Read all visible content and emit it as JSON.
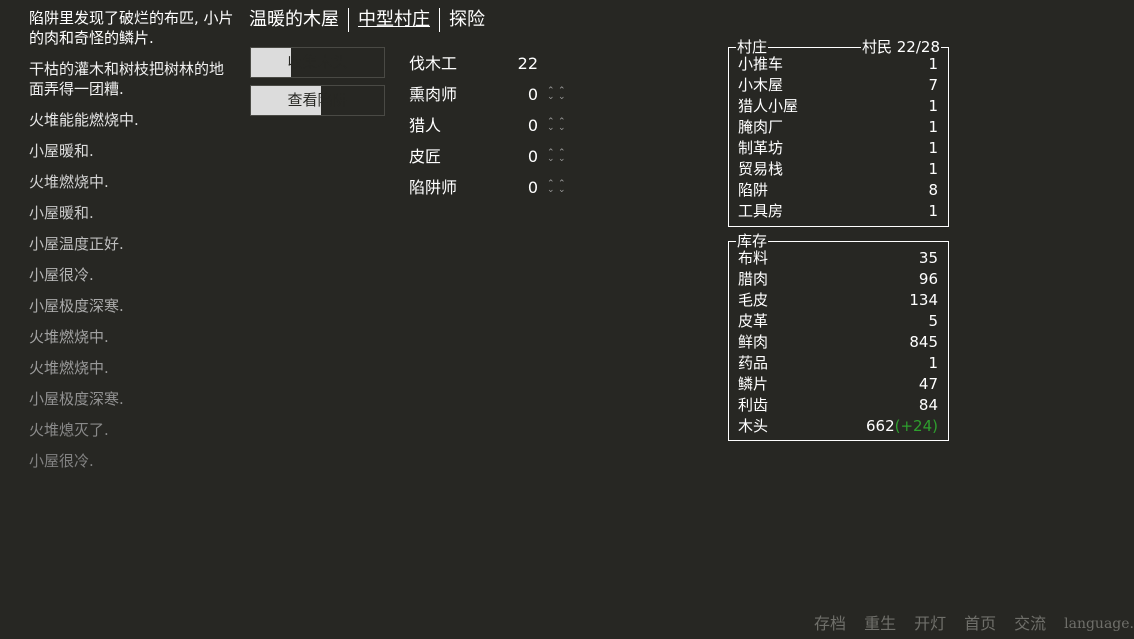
{
  "notifications": [
    {
      "text": "陷阱里发现了破烂的布匹, 小片的肉和奇怪的鳞片.",
      "color": "#ffffff"
    },
    {
      "text": "干枯的灌木和树枝把树林的地面弄得一团糟.",
      "color": "#f0f0f0"
    },
    {
      "text": "火堆能能燃烧中.",
      "color": "#e6e6e6"
    },
    {
      "text": "小屋暖和.",
      "color": "#dcdcdc"
    },
    {
      "text": "火堆燃烧中.",
      "color": "#d2d2d2"
    },
    {
      "text": "小屋暖和.",
      "color": "#c8c8c8"
    },
    {
      "text": "小屋温度正好.",
      "color": "#bebebe"
    },
    {
      "text": "小屋很冷.",
      "color": "#b4b4b4"
    },
    {
      "text": "小屋极度深寒.",
      "color": "#aaaaaa"
    },
    {
      "text": "火堆燃烧中.",
      "color": "#a2a2a2"
    },
    {
      "text": "火堆燃烧中.",
      "color": "#9a9a9a"
    },
    {
      "text": "小屋极度深寒.",
      "color": "#929292"
    },
    {
      "text": "火堆熄灭了.",
      "color": "#8a8a8a"
    },
    {
      "text": "小屋很冷.",
      "color": "#828282"
    }
  ],
  "header": {
    "tabs": [
      {
        "label": "温暖的木屋",
        "selected": false
      },
      {
        "label": "中型村庄",
        "selected": true
      },
      {
        "label": "探险",
        "selected": false
      }
    ]
  },
  "actions": {
    "gather": {
      "label": "收集木头",
      "cooldown_progress": 0.3
    },
    "traps": {
      "label": "查看陷阱",
      "cooldown_progress": 0.53
    }
  },
  "workers": [
    {
      "name": "伐木工",
      "count": "22",
      "arrows": false
    },
    {
      "name": "熏肉师",
      "count": "0",
      "arrows": true
    },
    {
      "name": "猎人",
      "count": "0",
      "arrows": true
    },
    {
      "name": "皮匠",
      "count": "0",
      "arrows": true
    },
    {
      "name": "陷阱师",
      "count": "0",
      "arrows": true
    }
  ],
  "village": {
    "legend": "村庄",
    "population_label": "村民 22/28",
    "buildings": [
      {
        "name": "小推车",
        "count": "1"
      },
      {
        "name": "小木屋",
        "count": "7"
      },
      {
        "name": "猎人小屋",
        "count": "1"
      },
      {
        "name": "腌肉厂",
        "count": "1"
      },
      {
        "name": "制革坊",
        "count": "1"
      },
      {
        "name": "贸易栈",
        "count": "1"
      },
      {
        "name": "陷阱",
        "count": "8"
      },
      {
        "name": "工具房",
        "count": "1"
      }
    ]
  },
  "stores": {
    "legend": "库存",
    "items": [
      {
        "name": "布料",
        "count": "35",
        "income": ""
      },
      {
        "name": "腊肉",
        "count": "96",
        "income": ""
      },
      {
        "name": "毛皮",
        "count": "134",
        "income": ""
      },
      {
        "name": "皮革",
        "count": "5",
        "income": ""
      },
      {
        "name": "鲜肉",
        "count": "845",
        "income": ""
      },
      {
        "name": "药品",
        "count": "1",
        "income": ""
      },
      {
        "name": "鳞片",
        "count": "47",
        "income": ""
      },
      {
        "name": "利齿",
        "count": "84",
        "income": ""
      },
      {
        "name": "木头",
        "count": "662",
        "income": "(+24)"
      }
    ]
  },
  "footer": {
    "links": [
      "存档",
      "重生",
      "开灯",
      "首页",
      "交流",
      "language."
    ]
  },
  "colors": {
    "background": "#272723",
    "text": "#ffffff",
    "income": "#2e9f2e",
    "footer": "#6f6f6a",
    "button_fill": "#dcdcdc"
  },
  "icons": {
    "worker_increase": "double-chevron-up-icon",
    "worker_decrease": "double-chevron-down-icon"
  }
}
